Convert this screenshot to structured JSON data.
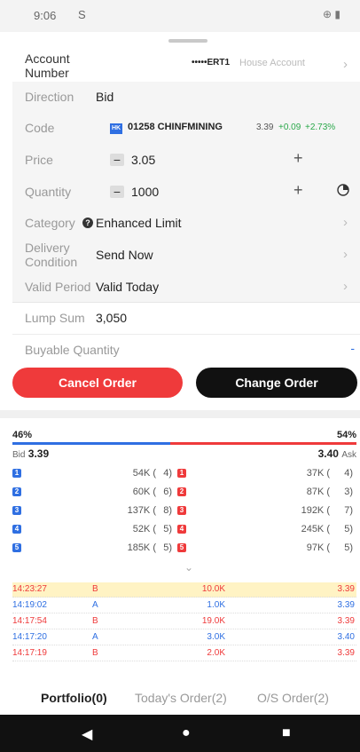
{
  "status": {
    "time": "9:06",
    "sim_icon": "S",
    "icons": "⊕ ▮"
  },
  "form": {
    "account_label": "Account Number",
    "account_value": "•••••ERT1",
    "account_type": "House Account",
    "direction_label": "Direction",
    "direction_value": "Bid",
    "code_label": "Code",
    "code_badge": "HK",
    "code_value": "01258 CHINFMINING",
    "code_price": "3.39",
    "code_change": "+0.09",
    "code_change_pct": "+2.73%",
    "price_label": "Price",
    "price_value": "3.05",
    "quantity_label": "Quantity",
    "quantity_value": "1000",
    "category_label": "Category",
    "category_value": "Enhanced Limit",
    "delivery_label": "Delivery Condition",
    "delivery_value": "Send Now",
    "valid_label": "Valid Period",
    "valid_value": "Valid Today",
    "lump_label": "Lump Sum",
    "lump_value": "3,050",
    "buyable_label": "Buyable Quantity",
    "buyable_value": "-"
  },
  "buttons": {
    "cancel": "Cancel Order",
    "change": "Change Order"
  },
  "depth": {
    "bid_pct": "46%",
    "ask_pct": "54%",
    "bid_share": 0.46,
    "bid_label": "Bid",
    "bid_price": "3.39",
    "ask_label": "Ask",
    "ask_price": "3.40",
    "levels": [
      {
        "lv": "1",
        "bid_qty": "54K (",
        "bid_cnt": "4)",
        "ask_qty": "37K (",
        "ask_cnt": "4)"
      },
      {
        "lv": "2",
        "bid_qty": "60K (",
        "bid_cnt": "6)",
        "ask_qty": "87K (",
        "ask_cnt": "3)"
      },
      {
        "lv": "3",
        "bid_qty": "137K (",
        "bid_cnt": "8)",
        "ask_qty": "192K (",
        "ask_cnt": "7)"
      },
      {
        "lv": "4",
        "bid_qty": "52K (",
        "bid_cnt": "5)",
        "ask_qty": "245K (",
        "ask_cnt": "5)"
      },
      {
        "lv": "5",
        "bid_qty": "185K (",
        "bid_cnt": "5)",
        "ask_qty": "97K (",
        "ask_cnt": "5)"
      }
    ]
  },
  "trades": [
    {
      "time": "14:23:27",
      "side": "B",
      "vol": "10.0K",
      "price": "3.39",
      "highlight": true
    },
    {
      "time": "14:19:02",
      "side": "A",
      "vol": "1.0K",
      "price": "3.39",
      "highlight": false
    },
    {
      "time": "14:17:54",
      "side": "B",
      "vol": "19.0K",
      "price": "3.39",
      "highlight": false
    },
    {
      "time": "14:17:20",
      "side": "A",
      "vol": "3.0K",
      "price": "3.40",
      "highlight": false
    },
    {
      "time": "14:17:19",
      "side": "B",
      "vol": "2.0K",
      "price": "3.39",
      "highlight": false
    }
  ],
  "tabs": [
    "Portfolio(0)",
    "Today's Order(2)",
    "O/S Order(2)"
  ],
  "colors": {
    "buy": "#ef3a3b",
    "sell": "#2f6fe2",
    "up": "#2aa84a",
    "highlight": "#fff3c4"
  }
}
